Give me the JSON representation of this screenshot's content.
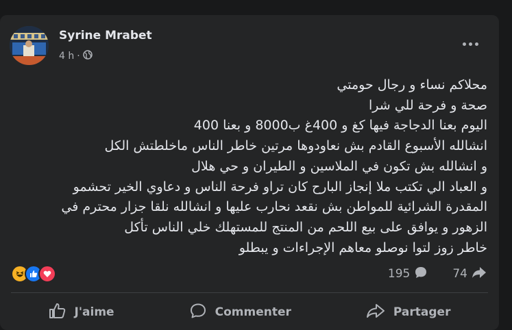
{
  "post": {
    "author": "Syrine Mrabet",
    "time": "4 h",
    "separator": "·",
    "privacy_icon": "globe-icon",
    "body_lines": [
      "محلاكم نساء و رجال حومتي",
      "صحة و فرحة للي شرا",
      "اليوم بعنا الدجاجة فيها كغ و 400غ ب8000 و بعنا 400",
      "انشالله الأسبوع القادم بش نعاودوها مرتين خاطر الناس ماخلطتش الكل",
      "و انشالله بش تكون في الملاسين و الطيران و حي هلال",
      "و العباد الي تكتب ملا إنجاز البارح كان تراو فرحة الناس و دعاوي الخير تحشمو",
      "المقدرة الشرائية للمواطن بش نقعد نحارب عليها و انشالله نلقا جزار محترم في",
      "الزهور و يوافق على بيع اللحم من المنتج للمستهلك خلي الناس تأكل",
      "خاطر زوز لتوا نوصلو معاهم الإجراءات و يبطلو"
    ]
  },
  "reactions": {
    "icons": [
      "haha-icon",
      "like-icon",
      "love-icon"
    ],
    "comment_count": "195",
    "share_count": "74"
  },
  "actions": {
    "like_label": "J'aime",
    "comment_label": "Commenter",
    "share_label": "Partager"
  },
  "colors": {
    "background": "#18191a",
    "card": "#242526",
    "text": "#e4e6eb",
    "muted": "#b0b3b8",
    "like_blue": "#1877f2",
    "love_red": "#f33e58",
    "haha_yellow": "#f7b125"
  }
}
